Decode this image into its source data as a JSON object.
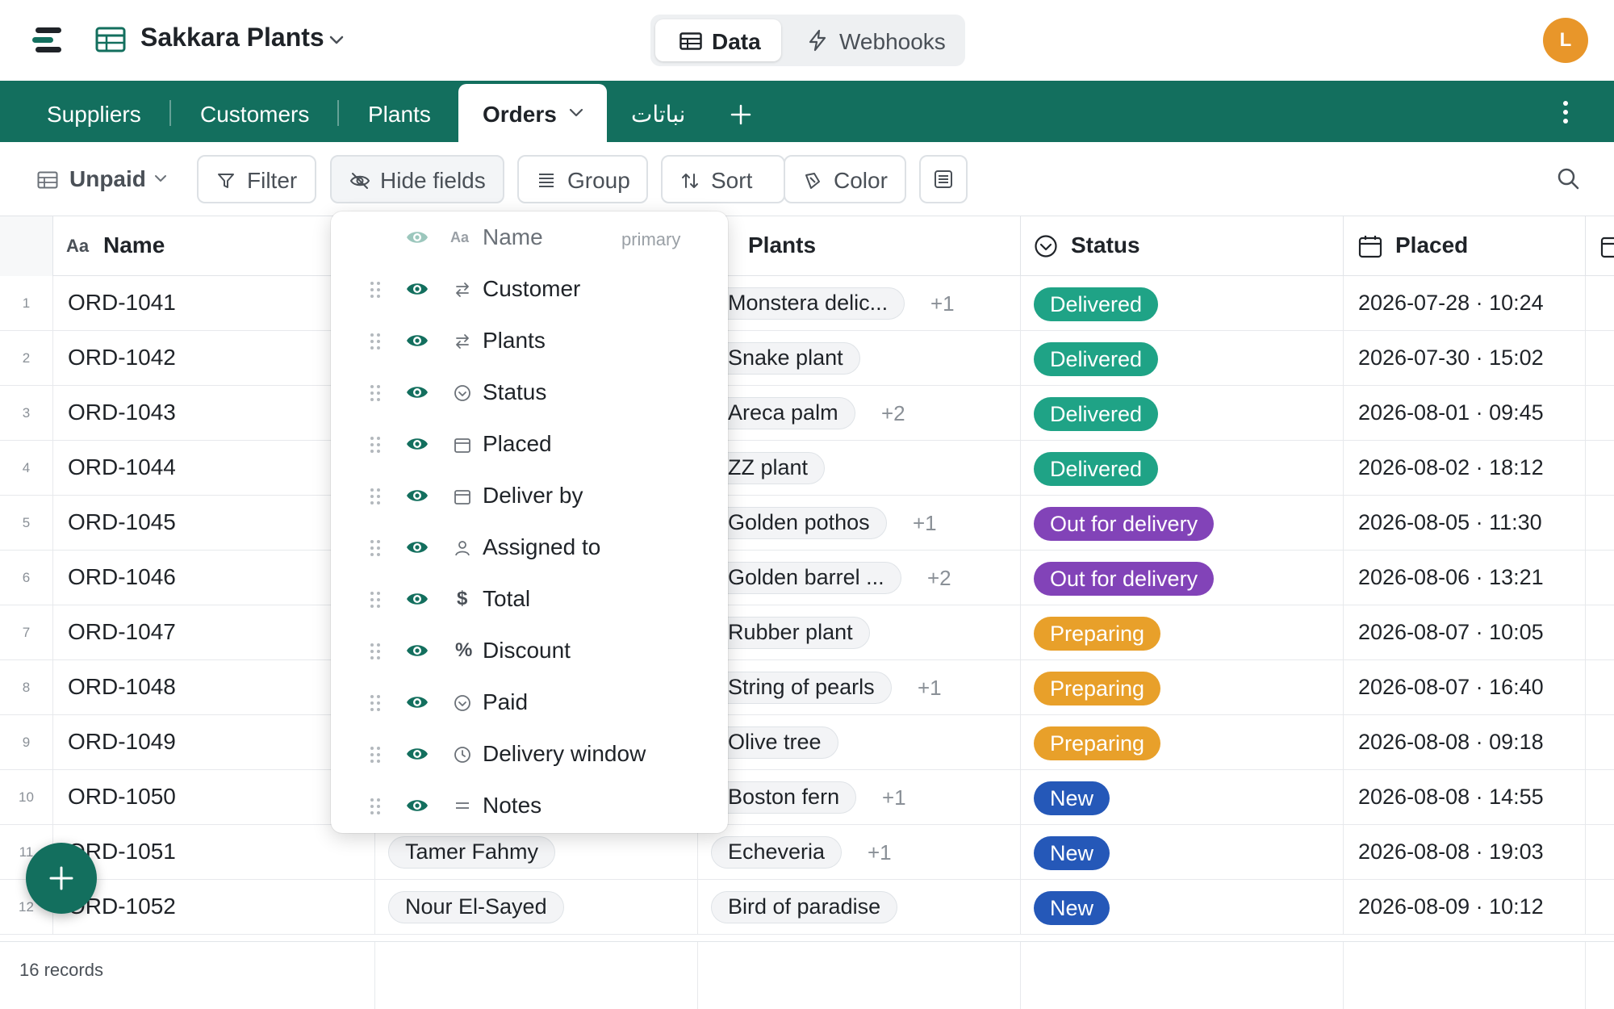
{
  "app": {
    "base_title": "Sakkara Plants",
    "modes": {
      "data": "Data",
      "webhooks": "Webhooks"
    },
    "avatar_initial": "L"
  },
  "tabs": [
    {
      "label": "Suppliers"
    },
    {
      "label": "Customers"
    },
    {
      "label": "Plants"
    },
    {
      "label": "Orders",
      "active": true
    },
    {
      "label": "نباتات"
    }
  ],
  "toolbar": {
    "view_name": "Unpaid",
    "filter": "Filter",
    "hide_fields": "Hide fields",
    "group": "Group",
    "sort": "Sort",
    "color": "Color"
  },
  "columns": {
    "name": "Name",
    "plants": "Plants",
    "status": "Status",
    "placed": "Placed"
  },
  "rows": [
    {
      "num": "1",
      "name": "ORD-1041",
      "plant": "Monstera delic...",
      "more": "+1",
      "status": "Delivered",
      "placed": "2026-07-28 · 10:24"
    },
    {
      "num": "2",
      "name": "ORD-1042",
      "plant": "Snake plant",
      "more": "",
      "status": "Delivered",
      "placed": "2026-07-30 · 15:02"
    },
    {
      "num": "3",
      "name": "ORD-1043",
      "plant": "Areca palm",
      "more": "+2",
      "status": "Delivered",
      "placed": "2026-08-01 · 09:45"
    },
    {
      "num": "4",
      "name": "ORD-1044",
      "plant": "ZZ plant",
      "more": "",
      "status": "Delivered",
      "placed": "2026-08-02 · 18:12"
    },
    {
      "num": "5",
      "name": "ORD-1045",
      "plant": "Golden pothos",
      "more": "+1",
      "status": "Out for delivery",
      "placed": "2026-08-05 · 11:30"
    },
    {
      "num": "6",
      "name": "ORD-1046",
      "plant": "Golden barrel ...",
      "more": "+2",
      "status": "Out for delivery",
      "placed": "2026-08-06 · 13:21"
    },
    {
      "num": "7",
      "name": "ORD-1047",
      "plant": "Rubber plant",
      "more": "",
      "status": "Preparing",
      "placed": "2026-08-07 · 10:05"
    },
    {
      "num": "8",
      "name": "ORD-1048",
      "plant": "String of pearls",
      "more": "+1",
      "status": "Preparing",
      "placed": "2026-08-07 · 16:40"
    },
    {
      "num": "9",
      "name": "ORD-1049",
      "plant": "Olive tree",
      "more": "",
      "status": "Preparing",
      "placed": "2026-08-08 · 09:18"
    },
    {
      "num": "10",
      "name": "ORD-1050",
      "plant": "Boston fern",
      "more": "+1",
      "status": "New",
      "placed": "2026-08-08 · 14:55"
    },
    {
      "num": "11",
      "name": "ORD-1051",
      "customer": "Tamer Fahmy",
      "plant": "Echeveria",
      "more": "+1",
      "status": "New",
      "placed": "2026-08-08 · 19:03"
    },
    {
      "num": "12",
      "name": "ORD-1052",
      "customer": "Nour El-Sayed",
      "plant": "Bird of paradise",
      "more": "",
      "status": "New",
      "placed": "2026-08-09 · 10:12"
    }
  ],
  "status_colors": {
    "Delivered": "#1fa386",
    "Out for delivery": "#8243b8",
    "Preparing": "#e8a02a",
    "New": "#2558b8"
  },
  "footer": {
    "records": "16 records"
  },
  "hide_fields_popover": {
    "primary_tag": "primary",
    "fields": [
      {
        "label": "Name",
        "icon": "text-type-icon",
        "primary": true
      },
      {
        "label": "Customer",
        "icon": "link-arrows-icon"
      },
      {
        "label": "Plants",
        "icon": "link-arrows-icon"
      },
      {
        "label": "Status",
        "icon": "check-circle-icon"
      },
      {
        "label": "Placed",
        "icon": "calendar-icon"
      },
      {
        "label": "Deliver by",
        "icon": "calendar-icon"
      },
      {
        "label": "Assigned to",
        "icon": "person-icon"
      },
      {
        "label": "Total",
        "icon": "dollar-icon"
      },
      {
        "label": "Discount",
        "icon": "percent-icon"
      },
      {
        "label": "Paid",
        "icon": "check-circle-icon"
      },
      {
        "label": "Delivery window",
        "icon": "clock-icon"
      },
      {
        "label": "Notes",
        "icon": "text-lines-icon"
      }
    ]
  }
}
